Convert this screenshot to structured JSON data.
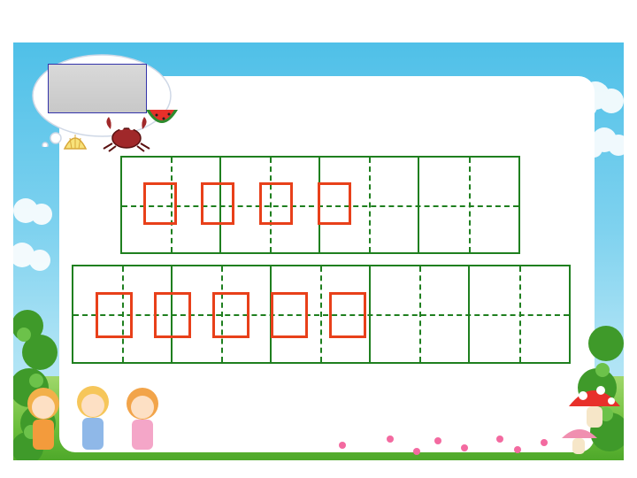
{
  "slide": {
    "title_box_text": "",
    "row1": {
      "cells": 8,
      "glyph_count": 4
    },
    "row2": {
      "cells": 10,
      "glyph_count": 5
    }
  },
  "colors": {
    "grid": "#1f7f1f",
    "glyph": "#e8401a",
    "sky": "#4fc0e8",
    "grass": "#6cbf3c",
    "title_box": "#cccccc"
  },
  "decorations": [
    "cloud-bubble",
    "crab-icon",
    "watermelon-icon",
    "shell-icon",
    "mushroom-icon",
    "children-illustration",
    "bush-icon",
    "cloud-icon"
  ]
}
